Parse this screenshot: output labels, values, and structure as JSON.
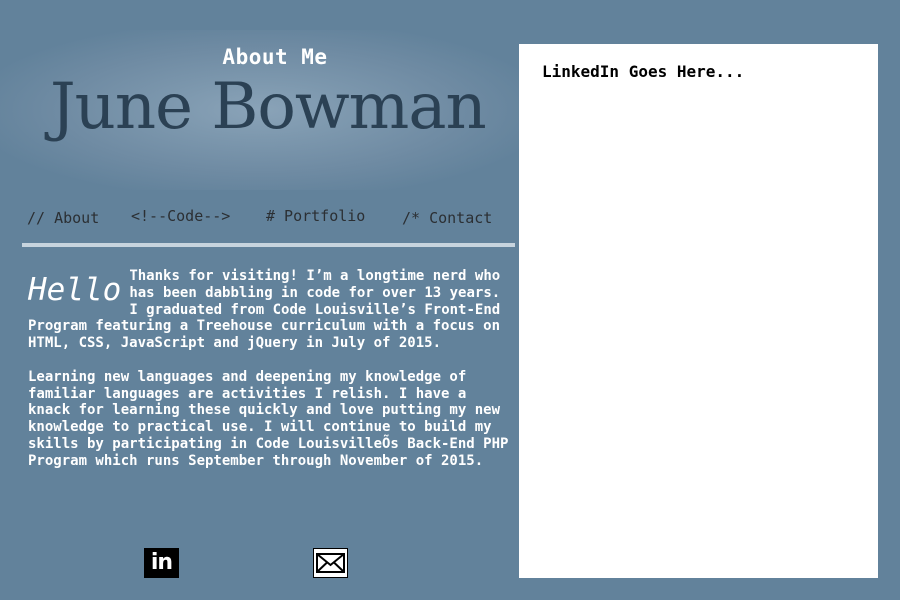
{
  "header": {
    "subtitle": "About Me",
    "name": "June Bowman"
  },
  "nav": {
    "items": [
      {
        "label": "// About"
      },
      {
        "label": "<!--Code-->"
      },
      {
        "label": "# Portfolio"
      },
      {
        "label": "/* Contact"
      }
    ]
  },
  "content": {
    "greeting": "Hello",
    "paragraph1": "Thanks for visiting! I’m a longtime nerd who has been dabbling in code for over 13 years. I graduated from Code Louisville’s Front-End Program featuring a Treehouse curriculum with a focus on HTML, CSS, JavaScript and jQuery in July of 2015.",
    "paragraph2": "Learning new languages and deepening my knowledge of familiar languages are activities I relish. I have a knack for learning these quickly and love putting my new knowledge to practical use. I will continue to build my skills by participating in Code LouisvilleÕs Back-End PHP Program which runs September through November of 2015."
  },
  "social": {
    "linkedin_label": "in",
    "linkedin_icon": "linkedin-icon",
    "mail_icon": "mail-icon"
  },
  "panel": {
    "text": "LinkedIn Goes Here..."
  },
  "colors": {
    "background": "#62829b",
    "name": "#2b4154",
    "panel": "#ffffff"
  }
}
